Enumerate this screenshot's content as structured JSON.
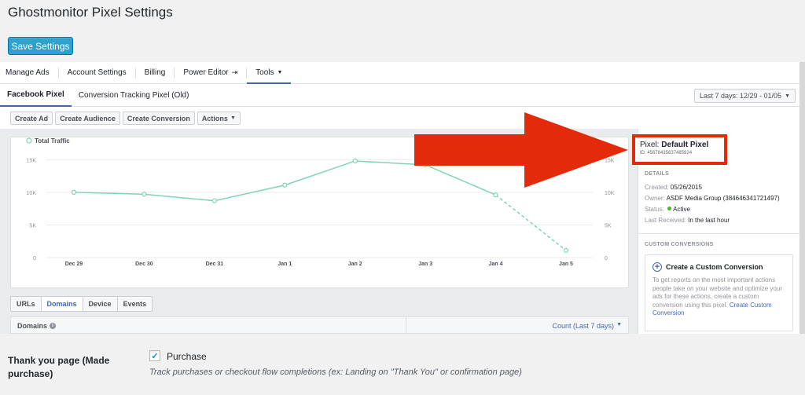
{
  "page": {
    "title": "Ghostmonitor Pixel Settings",
    "save_label": "Save Settings"
  },
  "fb": {
    "topnav": [
      "Manage Ads",
      "Account Settings",
      "Billing",
      "Power Editor",
      "Tools"
    ],
    "subtabs": [
      "Facebook Pixel",
      "Conversion Tracking Pixel (Old)"
    ],
    "date_range": "Last 7 days: 12/29 - 01/05",
    "action_buttons": [
      "Create Ad",
      "Create Audience",
      "Create Conversion",
      "Actions"
    ],
    "panel": {
      "pixel_prefix": "Pixel: ",
      "pixel_name": "Default Pixel",
      "pixel_id": "ID: 456784356374859​24",
      "details_head": "DETAILS",
      "created_label": "Created: ",
      "created_value": "05/26/2015",
      "owner_label": "Owner: ",
      "owner_value": "ASDF Media Group (384646341721497)",
      "status_label": "Status: ",
      "status_value": "Active",
      "last_label": "Last Received: ",
      "last_value": "In the last hour",
      "cc_head": "CUSTOM CONVERSIONS",
      "cc_title": "Create a Custom Conversion",
      "cc_text": "To get reports on the most important actions people take on your website and optimize your ads for these actions, create a custom conversion using this pixel.",
      "cc_link": "Create Custom Conversion"
    },
    "table_tabs": [
      "URLs",
      "Domains",
      "Device",
      "Events"
    ],
    "table_head": {
      "domains": "Domains",
      "count": "Count (Last 7 days)"
    }
  },
  "chart_data": {
    "type": "line",
    "legend": "Total Traffic",
    "right_label_partial": "raffic",
    "categories": [
      "Dec 29",
      "Dec 30",
      "Dec 31",
      "Jan 1",
      "Jan 2",
      "Jan 3",
      "Jan 4",
      "Jan 5"
    ],
    "series": [
      {
        "name": "Total Traffic",
        "values": [
          10000,
          9700,
          8700,
          11100,
          14800,
          14200,
          9600,
          1100
        ],
        "dashed_from_index": 6
      }
    ],
    "yticks": [
      0,
      5000,
      10000,
      15000
    ],
    "ytick_labels": [
      "0",
      "5K",
      "10K",
      "15K"
    ],
    "ylim": [
      0,
      16000
    ],
    "color": "#7fd3b6",
    "grid": true
  },
  "bottom": {
    "label": "Thank you page (Made purchase)",
    "checkbox_label": "Purchase",
    "checkbox_checked": true,
    "description": "Track purchases or checkout flow completions (ex: Landing on \"Thank You\" or confirmation page)"
  },
  "colors": {
    "accent": "#2ea2cc",
    "fb_blue": "#4267b2",
    "arrow": "#e32a0a",
    "status": "#42b72a"
  }
}
